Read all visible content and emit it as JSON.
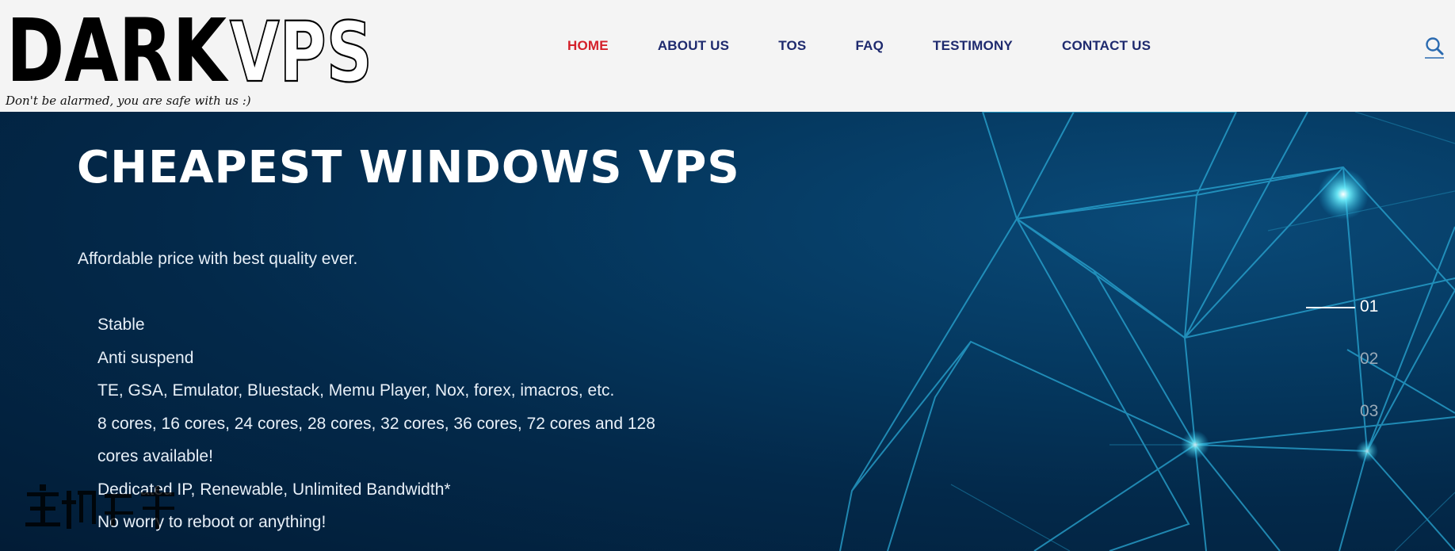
{
  "brand": {
    "logo_dark": "DARK",
    "logo_vps": "VPS",
    "tagline": "Don't be alarmed, you are safe with us :)"
  },
  "nav": {
    "items": [
      {
        "label": "HOME",
        "active": true
      },
      {
        "label": "ABOUT US",
        "active": false
      },
      {
        "label": "TOS",
        "active": false
      },
      {
        "label": "FAQ",
        "active": false
      },
      {
        "label": "TESTIMONY",
        "active": false
      },
      {
        "label": "CONTACT US",
        "active": false
      }
    ],
    "search_icon": "search-icon"
  },
  "hero": {
    "title": "CHEAPEST WINDOWS VPS",
    "subtitle": "Affordable price with best quality ever.",
    "features": [
      "Stable",
      "Anti suspend",
      "TE, GSA, Emulator, Bluestack, Memu Player, Nox, forex, imacros, etc.",
      "8 cores, 16 cores, 24 cores, 28 cores, 32 cores, 36 cores, 72 cores and 128 cores available!",
      "Dedicated IP, Renewable, Unlimited Bandwidth*",
      "No worry to reboot or anything!"
    ]
  },
  "slider": {
    "slides": [
      "01",
      "02",
      "03"
    ],
    "active_index": 0
  },
  "colors": {
    "nav_text": "#1e2a6e",
    "nav_active": "#d4202a",
    "hero_bg": "#03294a",
    "network_lines": "#2aa8d4"
  }
}
